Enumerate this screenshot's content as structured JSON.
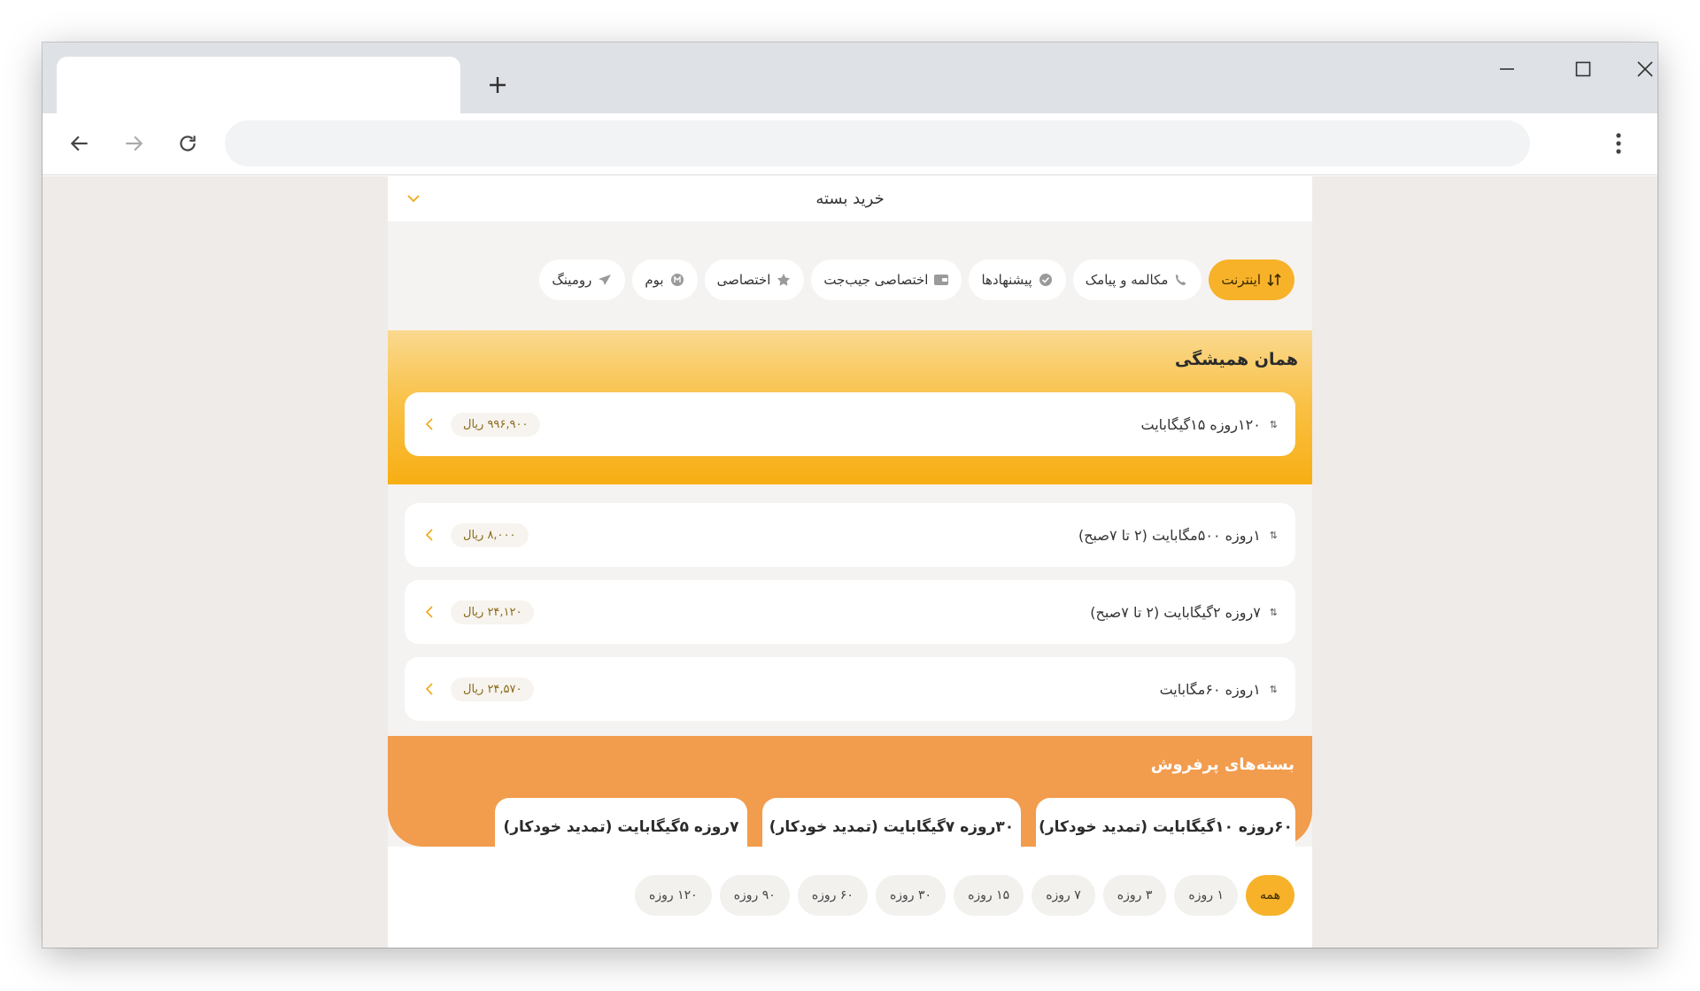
{
  "page": {
    "title": "خرید بسته"
  },
  "categories": [
    {
      "label": "اینترنت",
      "icon": "signal-icon",
      "active": true
    },
    {
      "label": "مکالمه و پیامک",
      "icon": "phone-icon",
      "active": false
    },
    {
      "label": "پیشنهادها",
      "icon": "check-badge-icon",
      "active": false
    },
    {
      "label": "اختصاصی جیب‌جت",
      "icon": "wallet-icon",
      "active": false
    },
    {
      "label": "اختصاصی",
      "icon": "star-icon",
      "active": false
    },
    {
      "label": "بوم",
      "icon": "boom-icon",
      "active": false
    },
    {
      "label": "رومینگ",
      "icon": "airplane-icon",
      "active": false
    }
  ],
  "featured": {
    "title": "همان همیشگی",
    "package": {
      "name": "۱۲۰روزه ۱۵گیگابایت",
      "price": "۹۹۶,۹۰۰ ریال"
    }
  },
  "packages": [
    {
      "name": "۱روزه ۵۰۰مگابایت (۲ تا ۷صبح)",
      "price": "۸,۰۰۰ ریال"
    },
    {
      "name": "۷روزه ۲گیگابایت (۲ تا ۷صبح)",
      "price": "۲۴,۱۲۰ ریال"
    },
    {
      "name": "۱روزه ۶۰مگابایت",
      "price": "۲۴,۵۷۰ ریال"
    }
  ],
  "best_sellers": {
    "title": "بسته‌های پرفروش",
    "items": [
      "۶۰روزه ۱۰گیگابایت (تمدید خودکار)",
      "۳۰روزه ۷گیگابایت (تمدید خودکار)",
      "۷روزه ۵گیگابایت (تمدید خودکار)"
    ]
  },
  "durations": [
    {
      "label": "همه",
      "active": true
    },
    {
      "label": "۱ روزه",
      "active": false
    },
    {
      "label": "۳ روزه",
      "active": false
    },
    {
      "label": "۷ روزه",
      "active": false
    },
    {
      "label": "۱۵ روزه",
      "active": false
    },
    {
      "label": "۳۰ روزه",
      "active": false
    },
    {
      "label": "۶۰ روزه",
      "active": false
    },
    {
      "label": "۹۰ روزه",
      "active": false
    },
    {
      "label": "۱۲۰ روزه",
      "active": false
    }
  ],
  "colors": {
    "accent": "#f7b22a",
    "best_sellers_bg": "#f29c4d",
    "page_bg": "#f5f3f1"
  }
}
